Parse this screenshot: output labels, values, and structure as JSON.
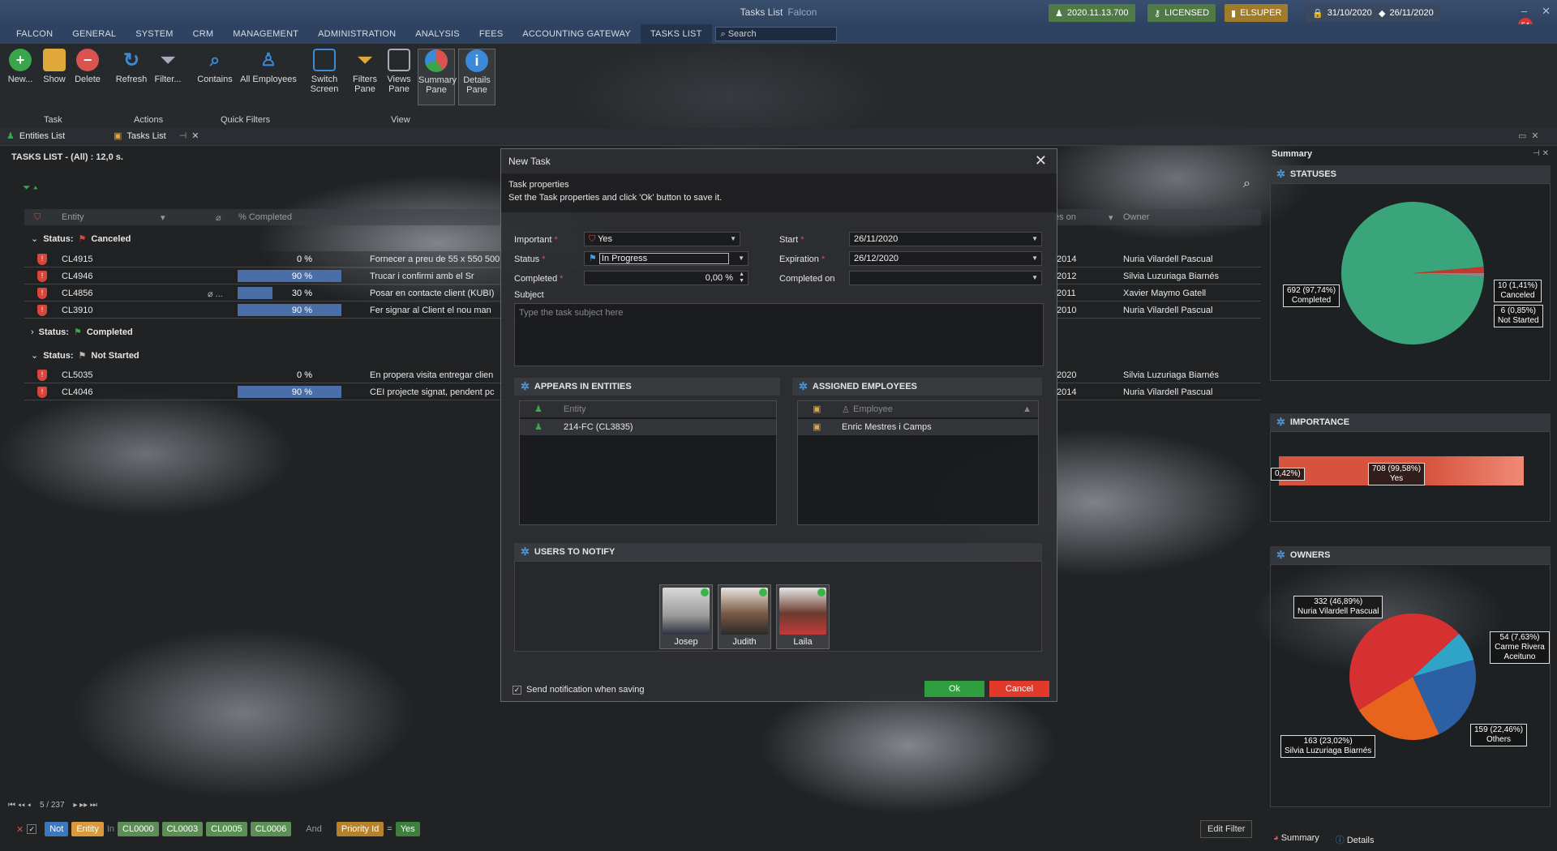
{
  "window": {
    "title": "Tasks List",
    "subtitle": "Falcon",
    "chips": [
      {
        "label": "2020.11.13.700",
        "color": "#4f7a45"
      },
      {
        "label": "LICENSED",
        "color": "#4f7a45"
      },
      {
        "label": "ELSUPER",
        "color": "#a07c2a"
      },
      {
        "label": "31/10/2020",
        "color": "#3b4960"
      },
      {
        "label": "26/11/2020",
        "color": "#3b4960"
      }
    ],
    "notify_count": "54"
  },
  "menu": {
    "items": [
      "FALCON",
      "GENERAL",
      "SYSTEM",
      "CRM",
      "MANAGEMENT",
      "ADMINISTRATION",
      "ANALYSIS",
      "FEES",
      "ACCOUNTING GATEWAY",
      "TASKS LIST"
    ],
    "search_placeholder": "Search"
  },
  "ribbon": {
    "buttons": [
      {
        "label": "New...",
        "icon": "plus-icon",
        "color": "#3aa54a"
      },
      {
        "label": "Show",
        "icon": "folder-icon",
        "color": "#e0a83a"
      },
      {
        "label": "Delete",
        "icon": "delete-icon",
        "color": "#d9534f"
      },
      {
        "label": "Refresh",
        "icon": "refresh-icon",
        "color": "#3a8ad9"
      },
      {
        "label": "Filter...",
        "icon": "filter-icon",
        "color": "#9aa0a6"
      },
      {
        "label": "Contains",
        "icon": "search-icon",
        "color": "#3a8ad9"
      },
      {
        "label": "All Employees",
        "icon": "user-icon",
        "color": "#3a8ad9"
      },
      {
        "label": "Switch Screen",
        "icon": "switch-screen-icon",
        "color": "#3a8ad9"
      },
      {
        "label": "Filters Pane",
        "icon": "filter-pane-icon",
        "color": "#e0a83a"
      },
      {
        "label": "Views Pane",
        "icon": "views-pane-icon",
        "color": "#9aa0a6"
      },
      {
        "label": "Summary Pane",
        "icon": "pie-chart-icon",
        "color": "#d9534f"
      },
      {
        "label": "Details Pane",
        "icon": "info-icon",
        "color": "#3a8ad9"
      }
    ],
    "groups": [
      "Task",
      "Actions",
      "Quick Filters",
      "View"
    ]
  },
  "tabs": [
    "Entities List",
    "Tasks List"
  ],
  "grid": {
    "title": "TASKS LIST - (All) : 12,0 s.",
    "columns": [
      "Entity",
      "% Completed",
      "",
      "es on",
      "Owner"
    ],
    "groups": [
      {
        "label": "Status:",
        "value": "Canceled",
        "rows": [
          {
            "entity": "CL4915",
            "pct": 0,
            "pct_label": "0 %",
            "desc": "Fornecer a preu de 55 x 550 500",
            "date": "/2014",
            "owner": "Nuria Vilardell Pascual"
          },
          {
            "entity": "CL4946",
            "pct": 90,
            "pct_label": "90 %",
            "desc": "Trucar i confirmi amb el Sr",
            "date": "/2012",
            "owner": "Silvia Luzuriaga Biarnés"
          },
          {
            "entity": "CL4856",
            "pct": 30,
            "pct_label": "30 %",
            "desc": "Posar en contacte client (KUBI)",
            "date": "/2011",
            "owner": "Xavier Maymo Gatell"
          },
          {
            "entity": "CL3910",
            "pct": 90,
            "pct_label": "90 %",
            "desc": "Fer signar al Client el nou man",
            "date": "/2010",
            "owner": "Nuria Vilardell Pascual"
          }
        ]
      },
      {
        "label": "Status:",
        "value": "Completed",
        "rows": []
      },
      {
        "label": "Status:",
        "value": "Not Started",
        "rows": [
          {
            "entity": "CL5035",
            "pct": 0,
            "pct_label": "0 %",
            "desc": "En propera visita entregar clien",
            "date": "/2020",
            "owner": "Silvia Luzuriaga Biarnés"
          },
          {
            "entity": "CL4046",
            "pct": 90,
            "pct_label": "90 %",
            "desc": "CEI projecte signat, pendent pc",
            "date": "/2014",
            "owner": "Nuria Vilardell Pascual"
          }
        ]
      }
    ],
    "pager": "5 / 237"
  },
  "filterbar": {
    "tokens": [
      {
        "text": "Not",
        "color": "#3a78c2"
      },
      {
        "text": "Entity",
        "color": "#d89a3a"
      },
      {
        "text": "In",
        "color": ""
      },
      {
        "text": "CL0000",
        "color": "#5b8f55"
      },
      {
        "text": "CL0003",
        "color": "#5b8f55"
      },
      {
        "text": "CL0005",
        "color": "#5b8f55"
      },
      {
        "text": "CL0006",
        "color": "#5b8f55"
      },
      {
        "text": "And",
        "color": ""
      },
      {
        "text": "Priority Id",
        "color": "#b5822a"
      },
      {
        "text": "=",
        "color": ""
      },
      {
        "text": "Yes",
        "color": "#3e7f3e"
      }
    ],
    "edit_filter": "Edit Filter"
  },
  "modal": {
    "title": "New Task",
    "section": "Task properties",
    "instructions": "Set the Task properties and click 'Ok' button to save it.",
    "important_label": "Important",
    "important_value": "Yes",
    "status_label": "Status",
    "status_value": "In Progress",
    "completed_label": "Completed",
    "completed_value": "0,00 %",
    "start_label": "Start",
    "start_value": "26/11/2020",
    "expiration_label": "Expiration",
    "expiration_value": "26/12/2020",
    "completed_on_label": "Completed on",
    "completed_on_value": "",
    "subject_label": "Subject",
    "subject_placeholder": "Type the task subject here",
    "entities_title": "APPEARS IN ENTITIES",
    "entities_col": "Entity",
    "entities_rows": [
      "214-FC  (CL3835)"
    ],
    "employees_title": "ASSIGNED EMPLOYEES",
    "employees_col": "Employee",
    "employees_rows": [
      "Enric Mestres i Camps"
    ],
    "notify_title": "USERS TO NOTIFY",
    "users": [
      {
        "name": "Josep",
        "color": "#b9b9b9"
      },
      {
        "name": "Judith",
        "color": "#a98b74"
      },
      {
        "name": "Laila",
        "color": "#9a6a5a"
      }
    ],
    "send_notification": "Send notification when saving",
    "ok": "Ok",
    "cancel": "Cancel"
  },
  "summary": {
    "title": "Summary",
    "statuses_title": "STATUSES",
    "statuses": [
      {
        "name": "Completed",
        "count": 692,
        "label": "692 (97,74%)",
        "color": "#3aa57a"
      },
      {
        "name": "Canceled",
        "count": 10,
        "label": "10 (1,41%)",
        "color": "#c0392b"
      },
      {
        "name": "Not Started",
        "count": 6,
        "label": "6 (0,85%)",
        "color": "#7f8c8d"
      }
    ],
    "importance_title": "IMPORTANCE",
    "importance": [
      {
        "name": "Yes",
        "count": 708,
        "label": "708 (99,58%)",
        "color": "#d6533f"
      },
      {
        "name": "",
        "count": 3,
        "label": "0,42%)",
        "color": "#2c3e50"
      }
    ],
    "owners_title": "OWNERS",
    "owners": [
      {
        "name": "Nuria Vilardell Pascual",
        "count": 332,
        "label": "332 (46,89%)",
        "color": "#d63031"
      },
      {
        "name": "Carme Rivera Aceituno",
        "count": 54,
        "label": "54 (7,63%)",
        "color": "#2fa4c6"
      },
      {
        "name": "Others",
        "count": 159,
        "label": "159 (22,46%)",
        "color": "#2d5fa5"
      },
      {
        "name": "Silvia Luzuriaga Biarnés",
        "count": 163,
        "label": "163 (23,02%)",
        "color": "#e8641c"
      }
    ],
    "bottom_tabs": [
      "Summary",
      "Details"
    ]
  }
}
